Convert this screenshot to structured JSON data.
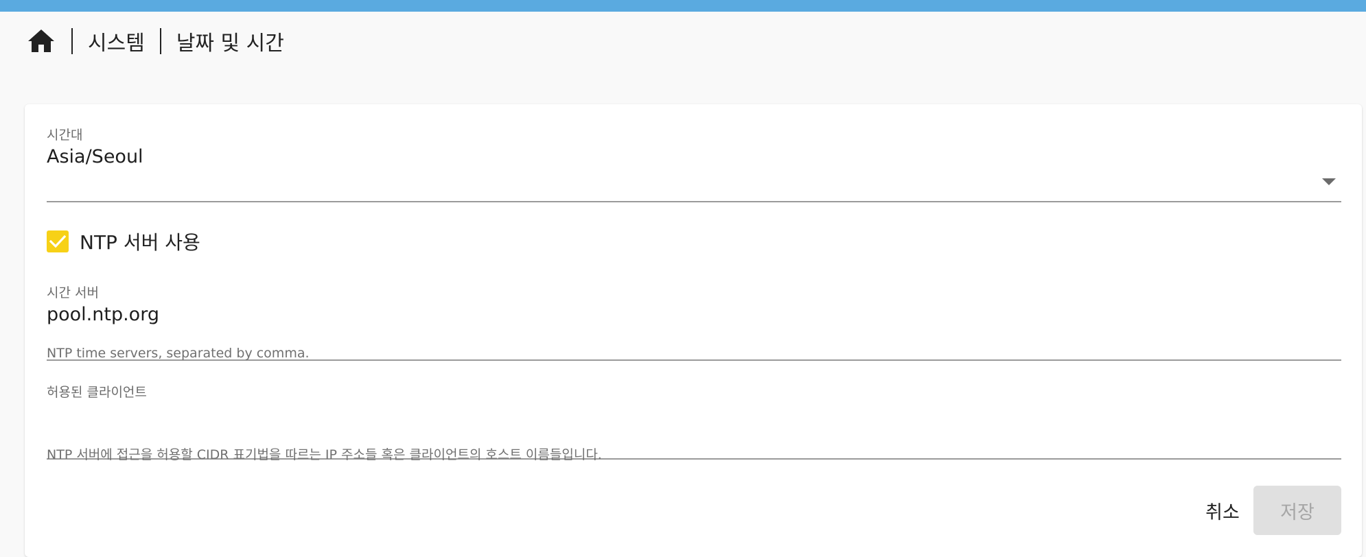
{
  "breadcrumb": {
    "home_icon": "home-icon",
    "items": [
      "시스템",
      "날짜 및 시간"
    ]
  },
  "form": {
    "timezone": {
      "label": "시간대",
      "value": "Asia/Seoul"
    },
    "ntp_checkbox": {
      "label": "NTP 서버 사용",
      "checked": true
    },
    "time_server": {
      "label": "시간 서버",
      "value": "pool.ntp.org",
      "helper": "NTP time servers, separated by comma."
    },
    "allowed_clients": {
      "label": "허용된 클라이언트",
      "value": "",
      "helper": "NTP 서버에 접근을 허용할 CIDR 표기법을 따르는 IP 주소들 혹은 클라이언트의 호스트 이름들입니다."
    }
  },
  "actions": {
    "cancel_label": "취소",
    "save_label": "저장",
    "save_enabled": false
  },
  "colors": {
    "topbar": "#5aaae0",
    "checkbox": "#f7d117",
    "background": "#f9f9f9"
  }
}
